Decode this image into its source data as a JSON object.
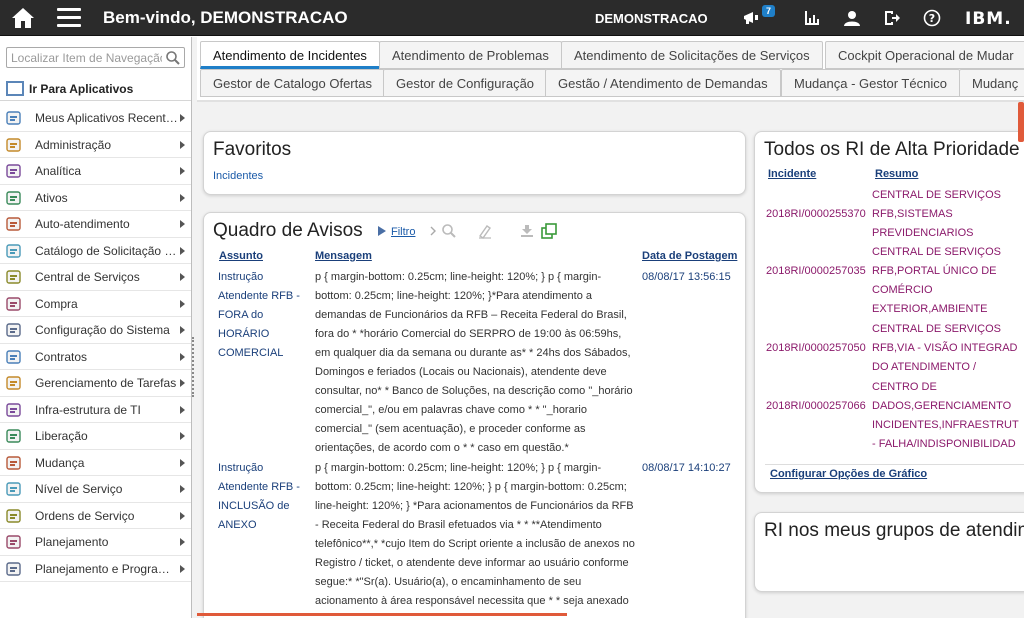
{
  "header": {
    "welcome": "Bem-vindo, DEMONSTRACAO",
    "user": "DEMONSTRACAO",
    "notification_count": "7",
    "brand": "IBM."
  },
  "sidebar": {
    "search_placeholder": "Localizar Item de Navegação",
    "go_apps": "Ir Para Aplicativos",
    "items": [
      {
        "label": "Meus Aplicativos Recentes",
        "icon": "recent-apps-icon"
      },
      {
        "label": "Administração",
        "icon": "admin-icon"
      },
      {
        "label": "Analítica",
        "icon": "analytics-icon"
      },
      {
        "label": "Ativos",
        "icon": "assets-icon"
      },
      {
        "label": "Auto-atendimento",
        "icon": "self-service-icon"
      },
      {
        "label": "Catálogo de Solicitação de Serviços",
        "icon": "catalog-icon"
      },
      {
        "label": "Central de Serviços",
        "icon": "service-desk-icon"
      },
      {
        "label": "Compra",
        "icon": "purchase-icon"
      },
      {
        "label": "Configuração do Sistema",
        "icon": "system-config-icon"
      },
      {
        "label": "Contratos",
        "icon": "contracts-icon"
      },
      {
        "label": "Gerenciamento de Tarefas",
        "icon": "tasks-icon"
      },
      {
        "label": "Infra-estrutura de TI",
        "icon": "it-infra-icon"
      },
      {
        "label": "Liberação",
        "icon": "release-icon"
      },
      {
        "label": "Mudança",
        "icon": "change-icon"
      },
      {
        "label": "Nível de Serviço",
        "icon": "service-level-icon"
      },
      {
        "label": "Ordens de Serviço",
        "icon": "work-orders-icon"
      },
      {
        "label": "Planejamento",
        "icon": "planning-icon"
      },
      {
        "label": "Planejamento e Programação",
        "icon": "scheduling-icon"
      }
    ]
  },
  "tabs": {
    "row1": [
      "Atendimento de Incidentes",
      "Atendimento de Problemas",
      "Atendimento de Solicitações de Serviços",
      "Cockpit Operacional de Mudar"
    ],
    "row2": [
      "Gestor de Catalogo Ofertas",
      "Gestor de Configuração",
      "Gestão / Atendimento de Demandas",
      "Mudança - Gestor Técnico",
      "Mudanç"
    ]
  },
  "favoritos": {
    "title": "Favoritos",
    "link": "Incidentes"
  },
  "quadro": {
    "title": "Quadro de Avisos",
    "filter": "Filtro",
    "columns": [
      "Assunto",
      "Mensagem",
      "Data de Postagem"
    ],
    "rows": [
      {
        "assunto": "Instrução Atendente RFB - FORA do HORÁRIO COMERCIAL",
        "mensagem": "p { margin-bottom: 0.25cm; line-height: 120%; } p { margin-bottom: 0.25cm; line-height: 120%; }*Para atendimento a demandas de Funcionários da RFB – Receita Federal do Brasil, fora do * *horário Comercial do SERPRO de 19:00 às 06:59hs, em qualquer dia da semana ou durante as* * 24hs dos Sábados, Domingos e feriados (Locais ou Nacionais), atendente deve consultar, no* * Banco de Soluções, na descrição como \"_horário comercial_\", e/ou em palavras chave como * * \"_horario comercial_\" (sem acentuação), e proceder conforme as orientações, de acordo com o * * caso em questão.*",
        "data": "08/08/17 13:56:15"
      },
      {
        "assunto": "Instrução Atendente RFB - INCLUSÃO de ANEXO",
        "mensagem": "p { margin-bottom: 0.25cm; line-height: 120%; } p { margin-bottom: 0.25cm; line-height: 120%; } p { margin-bottom: 0.25cm; line-height: 120%; } *Para acionamentos de Funcionários da RFB - Receita Federal do Brasil efetuados via * * **Atendimento telefônico**,* *cujo Item do Script oriente a inclusão de anexos no Registro / ticket, o atendente deve informar ao usuário conforme segue:* *\"Sr(a). Usuário(a), o encaminhamento de seu acionamento à área responsável necessita que * * seja anexado",
        "data": "08/08/17 14:10:27"
      }
    ]
  },
  "ri_alta": {
    "title": "Todos os RI de Alta Prioridade (",
    "columns": [
      "Incidente",
      "Resumo"
    ],
    "rows": [
      {
        "id": "2018RI/0000255370",
        "resumo": "CENTRAL DE SERVIÇOS RFB,SISTEMAS PREVIDENCIARIOS"
      },
      {
        "id": "2018RI/0000257035",
        "resumo": "CENTRAL DE SERVIÇOS RFB,PORTAL ÚNICO DE COMÉRCIO EXTERIOR,AMBIENTE"
      },
      {
        "id": "2018RI/0000257050",
        "resumo": "CENTRAL DE SERVIÇOS RFB,VIA - VISÃO INTEGRAD DO ATENDIMENTO /"
      },
      {
        "id": "2018RI/0000257066",
        "resumo": "CENTRO DE DADOS,GERENCIAMENTO INCIDENTES,INFRAESTRUT - FALHA/INDISPONIBILIDAD"
      }
    ],
    "config_link": "Configurar Opções de Gráfico"
  },
  "ri_grupos": {
    "title": "RI nos meus grupos de atendim"
  }
}
